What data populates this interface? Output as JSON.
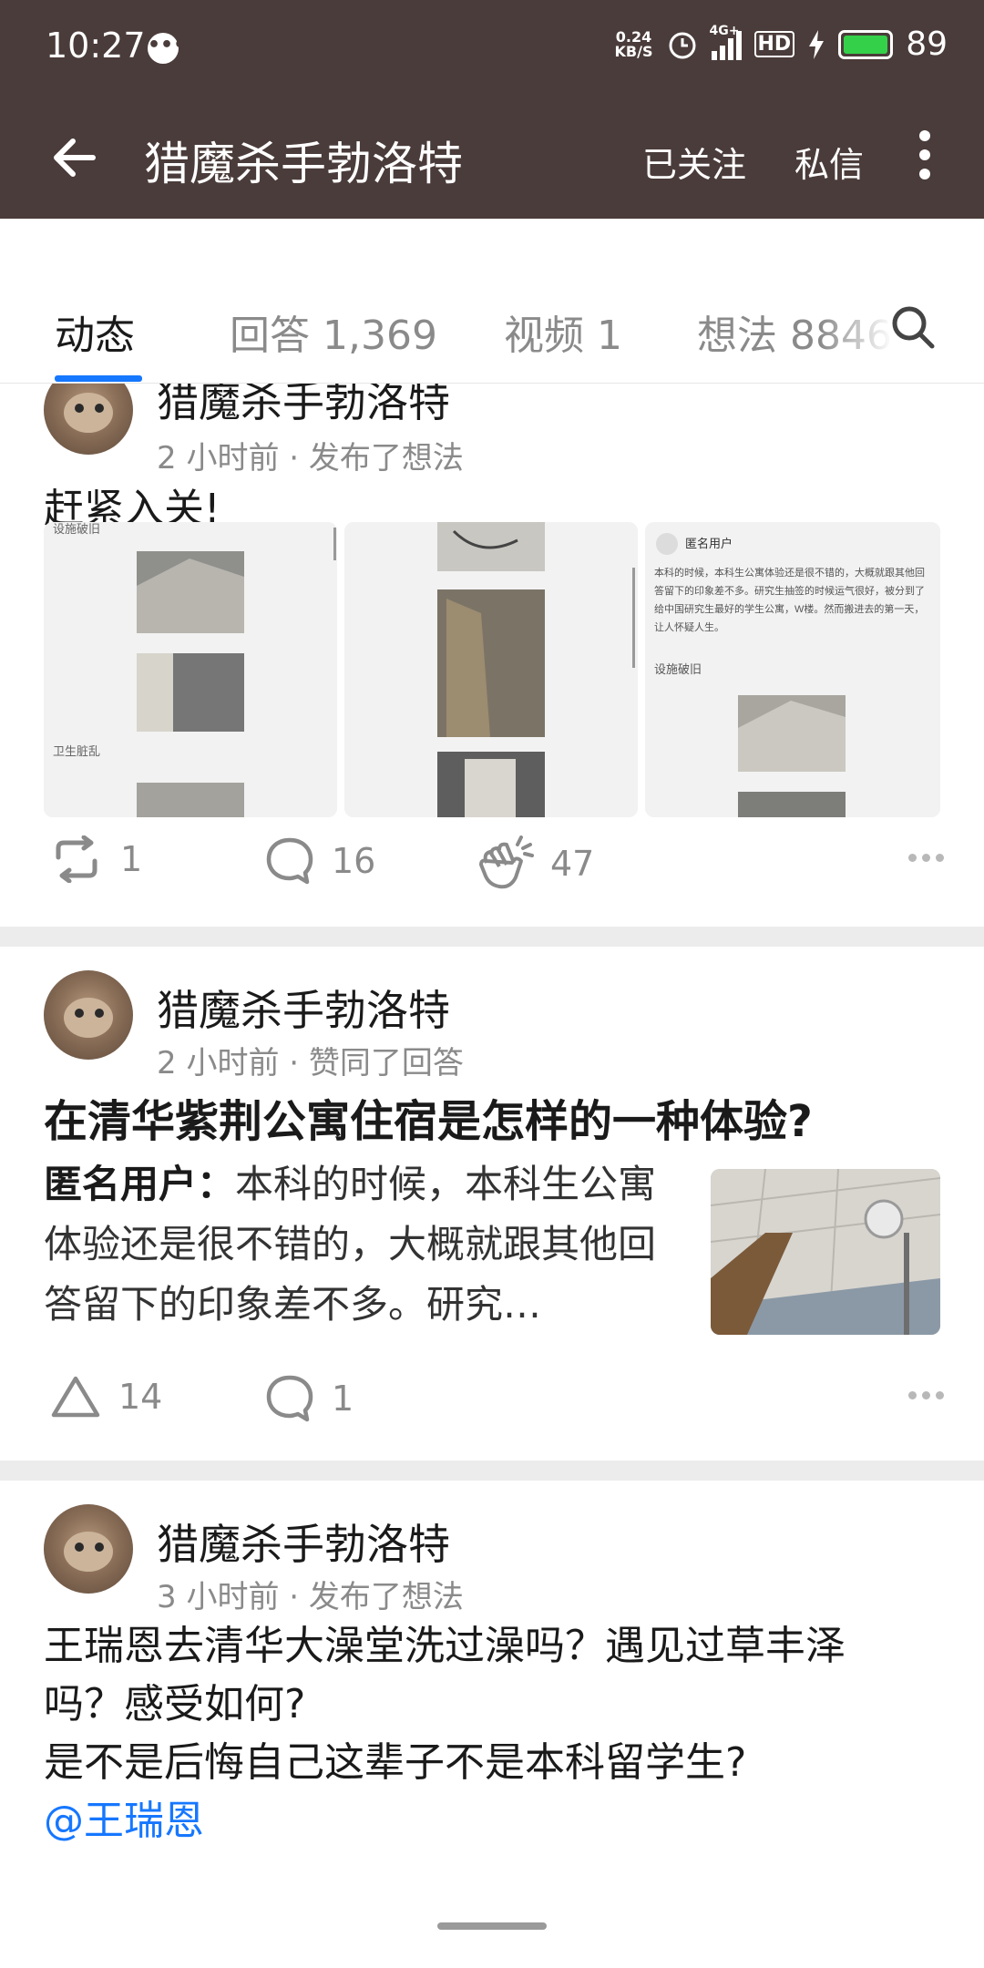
{
  "status_bar": {
    "time": "10:27",
    "speed_value": "0.24",
    "speed_unit": "KB/S",
    "network": "4G+",
    "hd": "HD",
    "battery": "89"
  },
  "app_bar": {
    "title": "猎魔杀手勃洛特",
    "follow_label": "已关注",
    "message_label": "私信"
  },
  "tabs": [
    {
      "label": "动态",
      "active": true
    },
    {
      "label": "回答 1,369",
      "active": false
    },
    {
      "label": "视频 1",
      "active": false
    },
    {
      "label": "想法 8846",
      "active": false
    }
  ],
  "posts": [
    {
      "author": "猎魔杀手勃洛特",
      "meta": "2 小时前 · 发布了想法",
      "text": "赶紧入关!",
      "images": [
        {
          "caption_top": "设施破旧",
          "caption_bottom": "卫生脏乱"
        },
        {},
        {
          "header": "匿名用户",
          "body": "本科的时候，本科生公寓体验还是很不错的，大概就跟其他回答留下的印象差不多。研究生抽签的时候运气很好，被分到了给中国研究生最好的学生公寓，W楼。然而搬进去的第一天，让人怀疑人生。",
          "caption": "设施破旧"
        }
      ],
      "reposts": "1",
      "comments": "16",
      "claps": "47"
    },
    {
      "author": "猎魔杀手勃洛特",
      "meta": "2 小时前 · 赞同了回答",
      "question": "在清华紫荆公寓住宿是怎样的一种体验?",
      "excerpt_author": "匿名用户：",
      "excerpt": "本科的时候，本科生公寓体验还是很不错的，大概就跟其他回答留下的印象差不多。研究…",
      "upvotes": "14",
      "comments": "1"
    },
    {
      "author": "猎魔杀手勃洛特",
      "meta": "3 小时前 · 发布了想法",
      "line1": "王瑞恩去清华大澡堂洗过澡吗？遇见过草丰泽",
      "line2": "吗？感受如何?",
      "line3": "是不是后悔自己这辈子不是本科留学生?",
      "mention": "@王瑞恩"
    }
  ],
  "colors": {
    "header_bg": "#4a3c3a",
    "accent": "#1677ff",
    "battery": "#35d04a"
  }
}
